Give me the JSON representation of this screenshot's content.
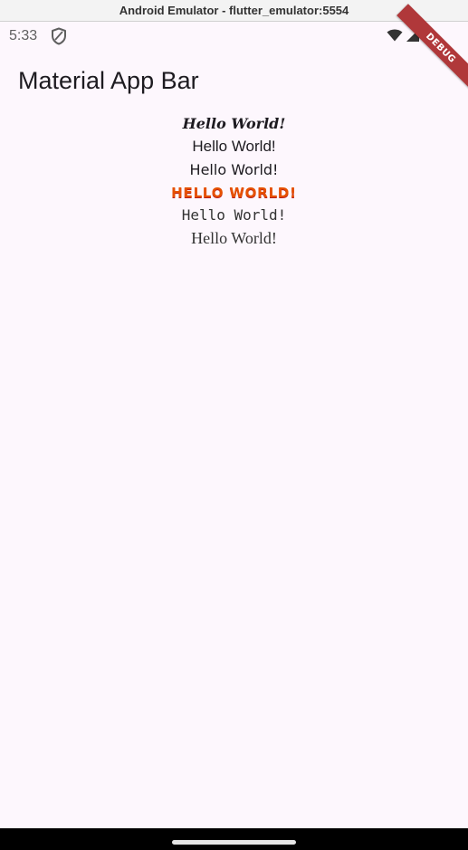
{
  "window": {
    "title": "Android Emulator - flutter_emulator:5554"
  },
  "status_bar": {
    "time": "5:33",
    "icons": [
      "shield-icon",
      "wifi-icon",
      "signal-icon"
    ]
  },
  "debug_banner": {
    "label": "DEBUG",
    "color": "#b0383a"
  },
  "app_bar": {
    "title": "Material App Bar"
  },
  "content": {
    "lines": [
      "Hello World!",
      "Hello World!",
      "Hello World!",
      "HELLO WORLD!",
      "Hello World!",
      "Hello World!"
    ]
  },
  "colors": {
    "background": "#fdf7fd",
    "text": "#1d1b20",
    "accent_orange": "#e65100"
  }
}
